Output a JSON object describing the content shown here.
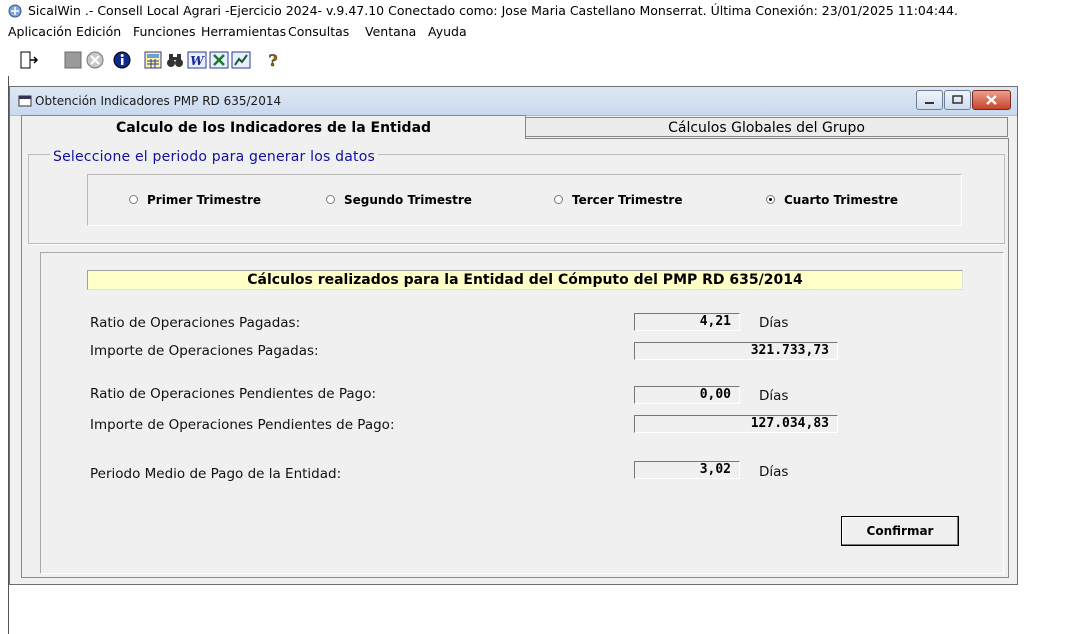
{
  "app": {
    "title": "SicalWin .- Consell Local Agrari -Ejercicio 2024- v.9.47.10 Conectado como: Jose Maria Castellano Monserrat. Última Conexión: 23/01/2025 11:04:44."
  },
  "menu": [
    "Aplicación",
    "Edición",
    "Funciones",
    "Herramientas",
    "Consultas",
    "Ventana",
    "Ayuda"
  ],
  "toolbar": {
    "icons": [
      "exit-icon",
      "stop-icon",
      "cancel-icon",
      "info-icon",
      "calculator-icon",
      "binoculars-icon",
      "word-icon",
      "excel-icon",
      "chart-icon",
      "help-icon"
    ]
  },
  "window": {
    "title": "Obtención Indicadores PMP RD 635/2014",
    "tabs": [
      "Calculo de los Indicadores de la Entidad",
      "Cálculos Globales del Grupo"
    ],
    "active_tab": 0
  },
  "period": {
    "legend": "Seleccione el periodo para generar los datos",
    "options": [
      "Primer Trimestre",
      "Segundo Trimestre",
      "Tercer Trimestre",
      "Cuarto Trimestre"
    ],
    "selected": "Cuarto Trimestre"
  },
  "results": {
    "banner": "Cálculos realizados para la Entidad del Cómputo del PMP RD 635/2014",
    "ratio_pagadas_label": "Ratio de Operaciones Pagadas:",
    "ratio_pagadas_value": "4,21",
    "ratio_pagadas_unit": "Días",
    "importe_pagadas_label": "Importe de Operaciones Pagadas:",
    "importe_pagadas_value": "321.733,73",
    "ratio_pendientes_label": "Ratio de Operaciones Pendientes de Pago:",
    "ratio_pendientes_value": "0,00",
    "ratio_pendientes_unit": "Días",
    "importe_pendientes_label": "Importe de Operaciones Pendientes de Pago:",
    "importe_pendientes_value": "127.034,83",
    "pmp_label": "Periodo Medio de Pago de la Entidad:",
    "pmp_value": "3,02",
    "pmp_unit": "Días"
  },
  "buttons": {
    "confirm": "Confirmar"
  }
}
